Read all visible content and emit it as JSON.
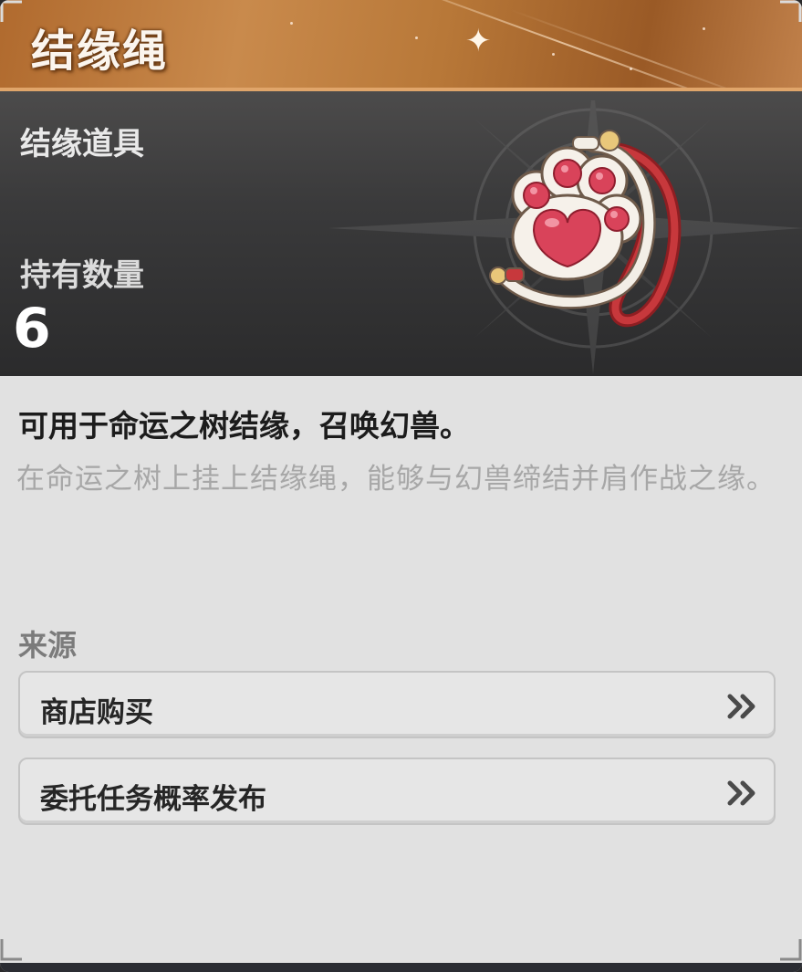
{
  "item": {
    "name": "结缘绳",
    "category": "结缘道具",
    "quantity_label": "持有数量",
    "quantity": "6",
    "description": "可用于命运之树结缘，召唤幻兽。",
    "lore": "在命运之树上挂上结缘绳，能够与幻兽缔结并肩作战之缘。"
  },
  "sources": {
    "label": "来源",
    "items": [
      {
        "label": "商店购买",
        "icon": "double-chevron-right-icon"
      },
      {
        "label": "委托任务概率发布",
        "icon": "double-chevron-right-icon"
      }
    ]
  },
  "colors": {
    "title_bar": "#b87838",
    "hero_bg": "#3a3a3b",
    "panel_bg": "#e1e1e1",
    "paw_pink": "#d9435a"
  }
}
